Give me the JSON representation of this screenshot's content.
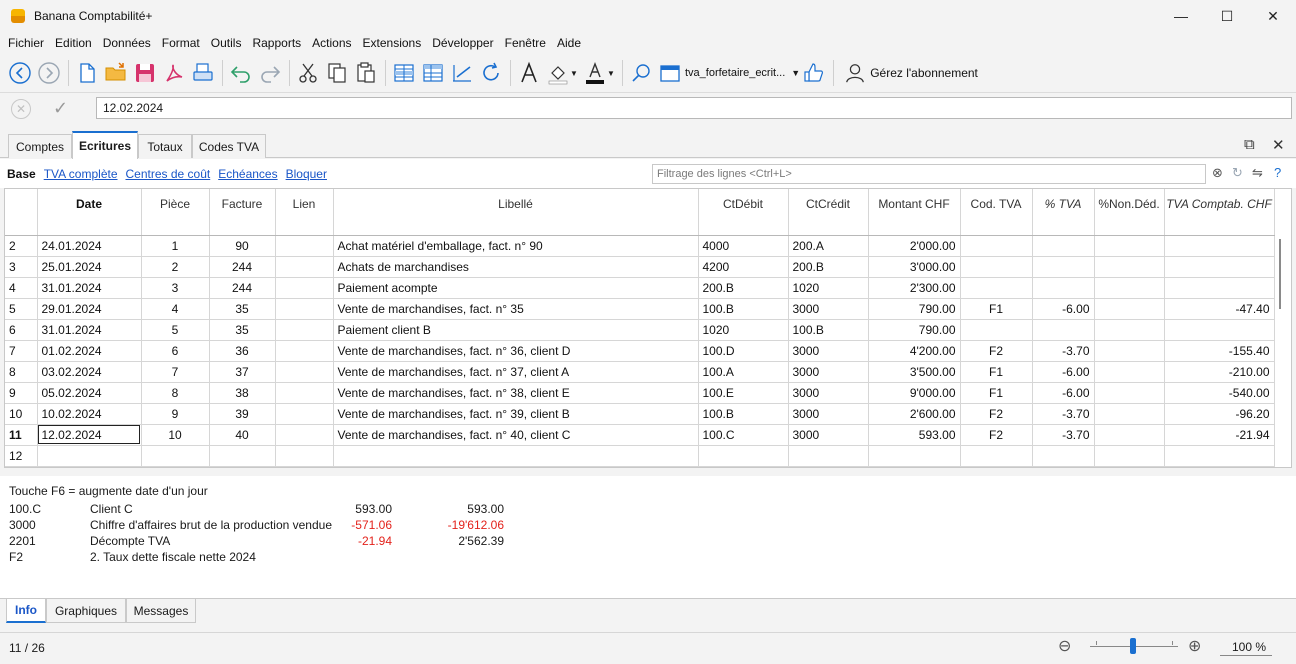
{
  "window": {
    "title": "Banana Comptabilité+",
    "minimize": "—",
    "maximize": "☐",
    "close": "✕"
  },
  "menu": [
    "Fichier",
    "Edition",
    "Données",
    "Format",
    "Outils",
    "Rapports",
    "Actions",
    "Extensions",
    "Développer",
    "Fenêtre",
    "Aide"
  ],
  "toolbar": {
    "file_name": "tva_forfetaire_ecrit...",
    "manage_label": "Gérez l'abonnement"
  },
  "edit": {
    "value": "12.02.2024",
    "cancel": "✕",
    "ok": "✓"
  },
  "doc_tabs": [
    "Comptes",
    "Ecritures",
    "Totaux",
    "Codes TVA"
  ],
  "doc_controls": {
    "restore": "⧉",
    "close": "✕"
  },
  "views": {
    "base": "Base",
    "links": [
      "TVA complète",
      "Centres de coût",
      "Echéances",
      "Bloquer"
    ]
  },
  "filter": {
    "placeholder": "Filtrage des lignes <Ctrl+L>"
  },
  "columns": [
    "",
    "Date",
    "Pièce",
    "Facture",
    "Lien",
    "Libellé",
    "CtDébit",
    "CtCrédit",
    "Montant CHF",
    "Cod. TVA",
    "% TVA",
    "%Non.Déd.",
    "TVA Comptab. CHF"
  ],
  "rows": [
    {
      "n": "2",
      "date": "24.01.2024",
      "piece": "1",
      "facture": "90",
      "lien": "",
      "libelle": "Achat matériel d'emballage, fact. n° 90",
      "debit": "4000",
      "credit": "200.A",
      "montant": "2'000.00",
      "code": "",
      "pct": "",
      "nondeduct": "",
      "tva": ""
    },
    {
      "n": "3",
      "date": "25.01.2024",
      "piece": "2",
      "facture": "244",
      "lien": "",
      "libelle": "Achats de marchandises",
      "debit": "4200",
      "credit": "200.B",
      "montant": "3'000.00",
      "code": "",
      "pct": "",
      "nondeduct": "",
      "tva": ""
    },
    {
      "n": "4",
      "date": "31.01.2024",
      "piece": "3",
      "facture": "244",
      "lien": "",
      "libelle": "Paiement acompte",
      "debit": "200.B",
      "credit": "1020",
      "montant": "2'300.00",
      "code": "",
      "pct": "",
      "nondeduct": "",
      "tva": ""
    },
    {
      "n": "5",
      "date": "29.01.2024",
      "piece": "4",
      "facture": "35",
      "lien": "",
      "libelle": "Vente de marchandises, fact. n° 35",
      "debit": "100.B",
      "credit": "3000",
      "montant": "790.00",
      "code": "F1",
      "pct": "-6.00",
      "nondeduct": "",
      "tva": "-47.40"
    },
    {
      "n": "6",
      "date": "31.01.2024",
      "piece": "5",
      "facture": "35",
      "lien": "",
      "libelle": "Paiement client B",
      "debit": "1020",
      "credit": "100.B",
      "montant": "790.00",
      "code": "",
      "pct": "",
      "nondeduct": "",
      "tva": ""
    },
    {
      "n": "7",
      "date": "01.02.2024",
      "piece": "6",
      "facture": "36",
      "lien": "",
      "libelle": "Vente de marchandises, fact. n° 36, client D",
      "debit": "100.D",
      "credit": "3000",
      "montant": "4'200.00",
      "code": "F2",
      "pct": "-3.70",
      "nondeduct": "",
      "tva": "-155.40"
    },
    {
      "n": "8",
      "date": "03.02.2024",
      "piece": "7",
      "facture": "37",
      "lien": "",
      "libelle": "Vente de marchandises, fact. n° 37, client A",
      "debit": "100.A",
      "credit": "3000",
      "montant": "3'500.00",
      "code": "F1",
      "pct": "-6.00",
      "nondeduct": "",
      "tva": "-210.00"
    },
    {
      "n": "9",
      "date": "05.02.2024",
      "piece": "8",
      "facture": "38",
      "lien": "",
      "libelle": "Vente de marchandises, fact. n° 38, client E",
      "debit": "100.E",
      "credit": "3000",
      "montant": "9'000.00",
      "code": "F1",
      "pct": "-6.00",
      "nondeduct": "",
      "tva": "-540.00"
    },
    {
      "n": "10",
      "date": "10.02.2024",
      "piece": "9",
      "facture": "39",
      "lien": "",
      "libelle": "Vente de marchandises, fact. n° 39, client B",
      "debit": "100.B",
      "credit": "3000",
      "montant": "2'600.00",
      "code": "F2",
      "pct": "-3.70",
      "nondeduct": "",
      "tva": "-96.20"
    },
    {
      "n": "11",
      "date": "12.02.2024",
      "piece": "10",
      "facture": "40",
      "lien": "",
      "libelle": "Vente de marchandises, fact. n° 40, client C",
      "debit": "100.C",
      "credit": "3000",
      "montant": "593.00",
      "code": "F2",
      "pct": "-3.70",
      "nondeduct": "",
      "tva": "-21.94"
    },
    {
      "n": "12",
      "date": "",
      "piece": "",
      "facture": "",
      "lien": "",
      "libelle": "",
      "debit": "",
      "credit": "",
      "montant": "",
      "code": "",
      "pct": "",
      "nondeduct": "",
      "tva": ""
    }
  ],
  "current_row": "11",
  "info": {
    "hint": "Touche F6 = augmente date d'un jour",
    "lines": [
      {
        "account": "100.C",
        "label": "Client C",
        "amount": "593.00",
        "balance": "593.00",
        "amount_neg": false,
        "balance_neg": false
      },
      {
        "account": "3000",
        "label": "Chiffre d'affaires brut de la production vendue",
        "amount": "-571.06",
        "balance": "-19'612.06",
        "amount_neg": true,
        "balance_neg": true
      },
      {
        "account": "2201",
        "label": "Décompte TVA",
        "amount": "-21.94",
        "balance": "2'562.39",
        "amount_neg": true,
        "balance_neg": false
      },
      {
        "account": "F2",
        "label": "2. Taux dette fiscale nette 2024",
        "amount": "",
        "balance": "",
        "amount_neg": false,
        "balance_neg": false
      }
    ]
  },
  "bottom_tabs": [
    "Info",
    "Graphiques",
    "Messages"
  ],
  "status": {
    "position": "11 / 26",
    "zoom": "100 %",
    "zoom_out": "⊖",
    "zoom_in": "⊕"
  }
}
